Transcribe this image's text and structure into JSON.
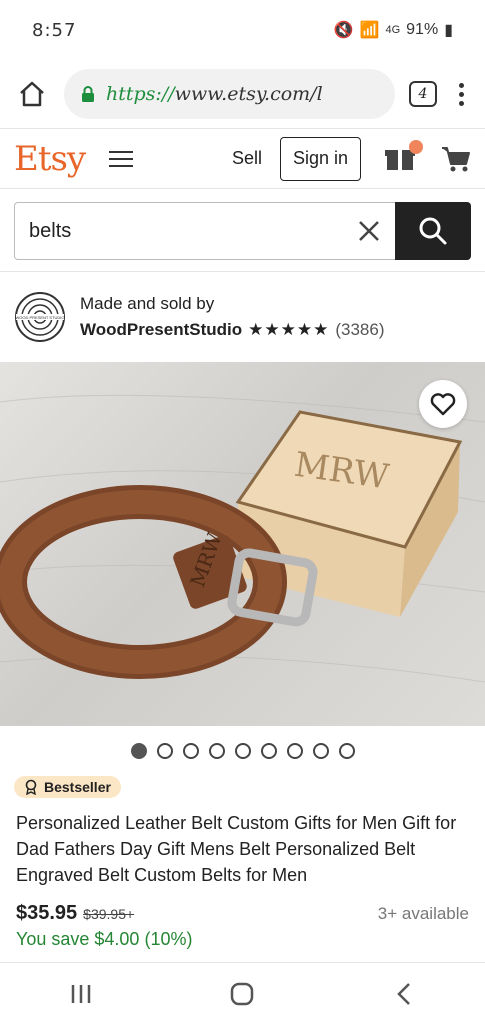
{
  "status": {
    "time": "8:57",
    "network": "4G",
    "battery": "91%"
  },
  "browser": {
    "url_scheme": "https://",
    "url_host": "www.etsy.com/l",
    "tab_count": "4"
  },
  "header": {
    "logo": "Etsy",
    "sell": "Sell",
    "signin": "Sign in"
  },
  "search": {
    "query": "belts"
  },
  "shop": {
    "made_by": "Made and sold by",
    "name": "WoodPresentStudio",
    "stars": "★★★★★",
    "reviews": "(3386)",
    "logo_text": "WOOD PRESENT STUDIO"
  },
  "hero": {
    "box_monogram": "MRW",
    "belt_monogram": "MRW"
  },
  "carousel": {
    "total": 9,
    "active": 0
  },
  "product": {
    "badge": "Bestseller",
    "title": "Personalized Leather Belt Custom Gifts for Men Gift for Dad Fathers Day Gift Mens Belt Personalized Belt Engraved Belt Custom Belts for Men",
    "price": "$35.95",
    "old_price": "$39.95+",
    "availability": "3+ available",
    "savings": "You save $4.00 (10%)"
  },
  "colors": {
    "brand": "#e8662a",
    "savings": "#258635",
    "badge_bg": "#fbe7c6",
    "notif": "#f0845a"
  },
  "icons": [
    "home-icon",
    "lock-icon",
    "tabs-icon",
    "more-icon",
    "hamburger-icon",
    "gift-icon",
    "cart-icon",
    "close-icon",
    "search-icon",
    "heart-icon",
    "award-icon",
    "recents-icon",
    "home-nav-icon",
    "back-icon"
  ]
}
